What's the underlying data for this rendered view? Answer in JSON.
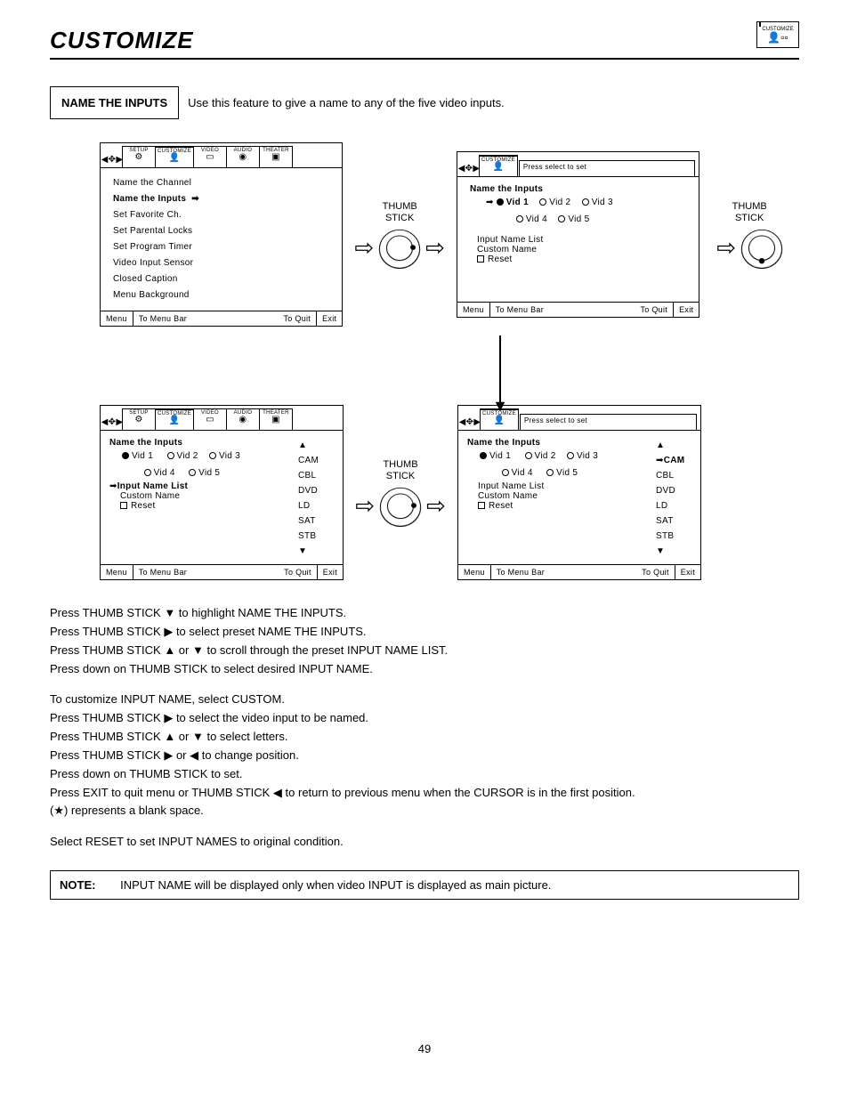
{
  "header": {
    "title": "CUSTOMIZE",
    "corner_tab": "CUSTOMIZE"
  },
  "section": {
    "box_label": "NAME THE INPUTS",
    "description": "Use this feature to give a name to any of the five video inputs."
  },
  "tabs": {
    "setup": "SETUP",
    "customize": "CUSTOMIZE",
    "video": "VIDEO",
    "audio": "AUDIO",
    "theater": "THEATER",
    "help_text": "Press select to set"
  },
  "thumb": {
    "label1": "THUMB",
    "label2": "STICK"
  },
  "screen1": {
    "items": [
      "Name the Channel",
      "Name the Inputs",
      "Set Favorite Ch.",
      "Set Parental Locks",
      "Set Program Timer",
      "Video Input Sensor",
      "Closed Caption",
      "Menu Background"
    ]
  },
  "screen2": {
    "title": "Name the Inputs",
    "vids": [
      "Vid 1",
      "Vid 2",
      "Vid 3",
      "Vid 4",
      "Vid 5"
    ],
    "opt1": "Input Name List",
    "opt2": "Custom Name",
    "opt3": "Reset"
  },
  "screen3": {
    "title": "Name the Inputs",
    "vids": [
      "Vid 1",
      "Vid 2",
      "Vid 3",
      "Vid 4",
      "Vid 5"
    ],
    "opt1": "Input Name List",
    "opt2": "Custom Name",
    "opt3": "Reset",
    "list": [
      "CAM",
      "CBL",
      "DVD",
      "LD",
      "SAT",
      "STB"
    ]
  },
  "screen4": {
    "title": "Name the Inputs",
    "vids": [
      "Vid 1",
      "Vid 2",
      "Vid 3",
      "Vid 4",
      "Vid 5"
    ],
    "opt1": "Input Name List",
    "opt2": "Custom Name",
    "opt3": "Reset",
    "list": [
      "CAM",
      "CBL",
      "DVD",
      "LD",
      "SAT",
      "STB"
    ]
  },
  "footer": {
    "menu": "Menu",
    "to_menu_bar": "To Menu Bar",
    "to_quit": "To Quit",
    "exit": "Exit"
  },
  "instructions": {
    "l1": "Press THUMB STICK ▼ to highlight NAME THE INPUTS.",
    "l2": "Press THUMB STICK ▶ to select preset NAME THE INPUTS.",
    "l3": "Press THUMB STICK ▲ or ▼ to scroll through the preset INPUT NAME LIST.",
    "l4": "Press down on THUMB STICK to select desired INPUT NAME.",
    "l5": "To customize INPUT NAME, select CUSTOM.",
    "l6": "Press THUMB STICK ▶ to select the video input to be named.",
    "l7": "Press THUMB STICK ▲ or ▼ to select letters.",
    "l8": "Press THUMB STICK ▶ or ◀ to change position.",
    "l9": "Press down on THUMB STICK to set.",
    "l10": "Press EXIT to quit menu or THUMB STICK ◀ to return to previous menu when the CURSOR is in the first position.",
    "l11": "(★) represents a blank space.",
    "l12": "Select RESET to set INPUT NAMES to original condition."
  },
  "note": {
    "label": "NOTE:",
    "text": "INPUT NAME will be displayed only when video INPUT is displayed as main picture."
  },
  "page_number": "49"
}
